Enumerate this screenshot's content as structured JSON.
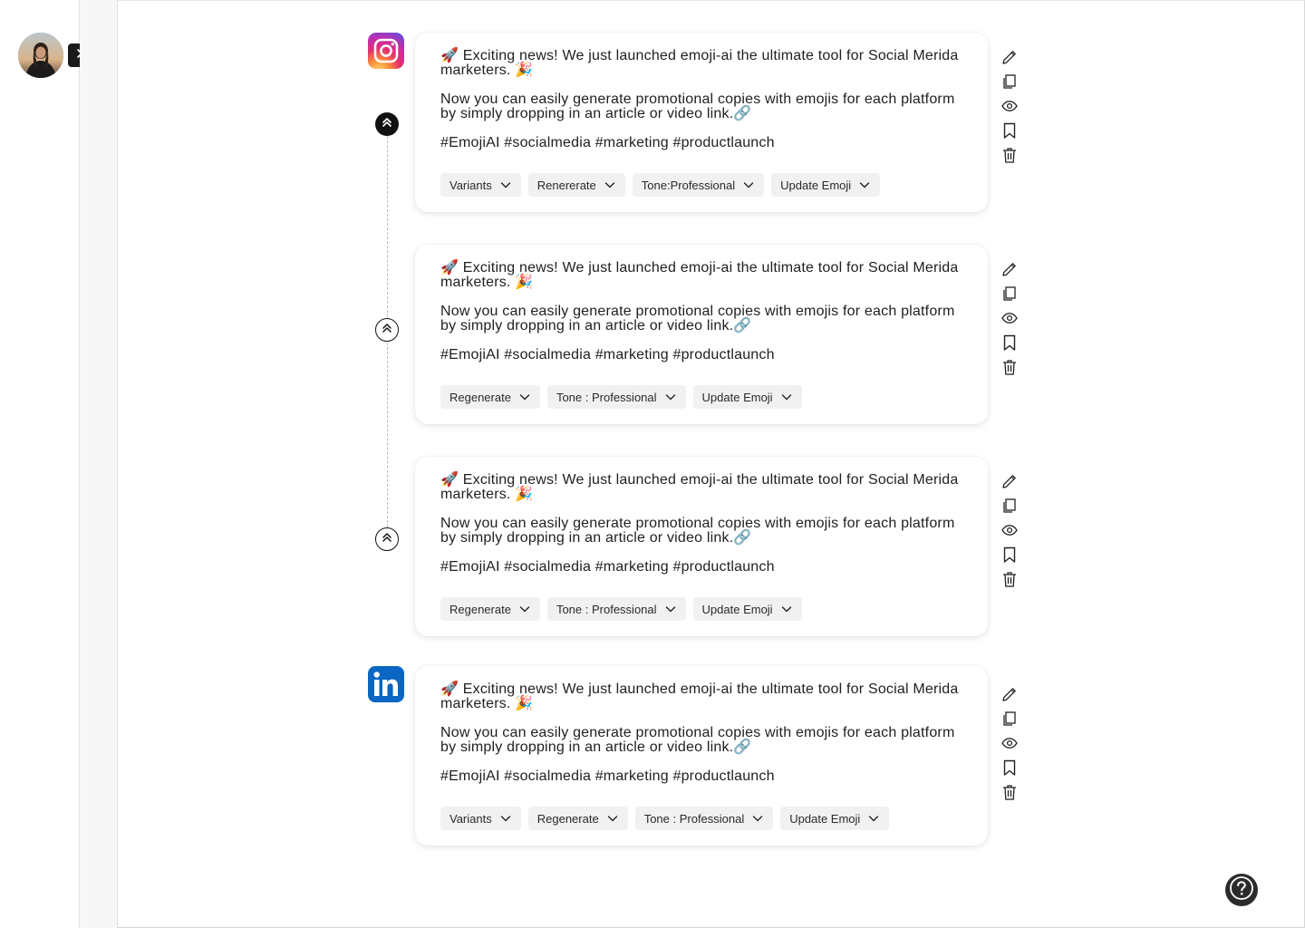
{
  "sidebar": {
    "avatar_label": "User avatar",
    "expand_icon": "chevron-right-icon"
  },
  "posts": [
    {
      "platform": "instagram",
      "line1": "🚀 Exciting news! We just launched emoji-ai the ultimate tool for Social Merida marketers. 🎉",
      "line2": "Now you can easily generate promotional copies with emojis for each platform by simply dropping in an article or video link.🔗",
      "tags": "#EmojiAI #socialmedia #marketing #productlaunch",
      "chips": [
        "Variants",
        "Renererate",
        "Tone:Professional",
        "Update Emoji"
      ]
    },
    {
      "platform": "",
      "line1": "🚀 Exciting news! We just launched emoji-ai the ultimate tool for Social Merida marketers. 🎉",
      "line2": "Now you can easily generate promotional copies with emojis for each platform by simply dropping in an article or video link.🔗",
      "tags": "#EmojiAI #socialmedia #marketing #productlaunch",
      "chips": [
        "Regenerate",
        "Tone : Professional",
        "Update Emoji"
      ]
    },
    {
      "platform": "",
      "line1": "🚀 Exciting news! We just launched emoji-ai the ultimate tool for Social Merida marketers. 🎉",
      "line2": "Now you can easily generate promotional copies with emojis for each platform by simply dropping in an article or video link.🔗",
      "tags": "#EmojiAI #socialmedia #marketing #productlaunch",
      "chips": [
        "Regenerate",
        "Tone : Professional",
        "Update Emoji"
      ]
    },
    {
      "platform": "linkedin",
      "line1": "🚀 Exciting news! We just launched emoji-ai the ultimate tool for Social Merida marketers. 🎉",
      "line2": "Now you can easily generate promotional copies with emojis for each platform by simply dropping in an article or video link.🔗",
      "tags": "#EmojiAI #socialmedia #marketing #productlaunch",
      "chips": [
        "Variants",
        "Regenerate",
        "Tone : Professional",
        "Update Emoji"
      ]
    }
  ],
  "actions": [
    "pencil-icon",
    "copy-icon",
    "eye-icon",
    "bookmark-icon",
    "trash-icon"
  ],
  "colors": {
    "accent": "#111111",
    "chip_bg": "#f1f1f1",
    "linkedin": "#0a66c2"
  },
  "help_icon": "question-mark-icon"
}
